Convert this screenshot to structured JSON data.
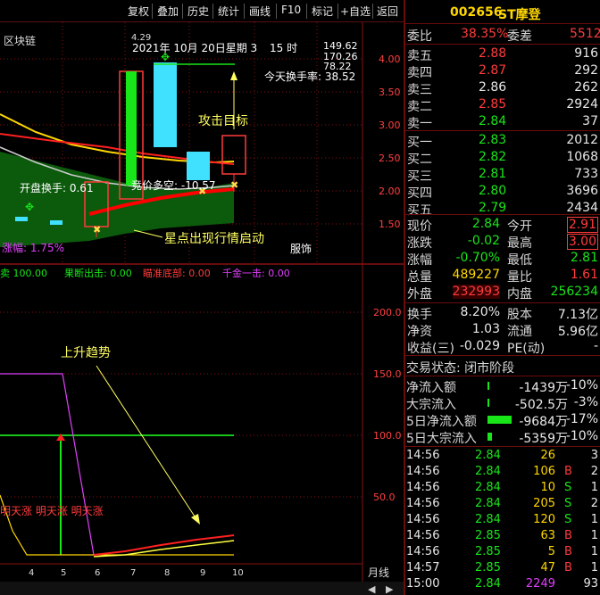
{
  "toolbar": {
    "buttons": [
      "复权",
      "叠加",
      "历史",
      "统计",
      "画线",
      "F10",
      "标记",
      "+自选",
      "返回"
    ]
  },
  "upper_chart": {
    "legend_left": "区块链",
    "date_label": "2021年 10月 20日星期 3",
    "time_label": "15 时",
    "marker_label": "4.29",
    "info_values": [
      "149.62",
      "170.26",
      "78.22"
    ],
    "turnover_label": "今天换手率: 38.52",
    "attack_label": "攻击目标",
    "open_turnover_label": "开盘换手: 0.61",
    "bid_label": "竞价多空: -10.57",
    "star_label": "星点出现行情启动",
    "rise_label": "涨幅: 1.75%",
    "obey_label": "服饰",
    "y_ticks": [
      "4.00",
      "3.50",
      "3.00",
      "2.50",
      "2.00",
      "1.50"
    ]
  },
  "lower_chart": {
    "indicators": [
      {
        "label": "卖 100.00",
        "color": "#19e619"
      },
      {
        "label": "果断出击: 0.00",
        "color": "#19e619"
      },
      {
        "label": "瞄准底部: 0.00",
        "color": "#ff3b3b"
      },
      {
        "label": "千金一击: 0.00",
        "color": "#e040fb"
      }
    ],
    "trend_label": "上升趋势",
    "tomorrow_label": "明天涨 明天涨 明天涨",
    "y_ticks": [
      "200.0",
      "150.0",
      "100.0",
      "50.0"
    ],
    "x_ticks": [
      "4",
      "5",
      "6",
      "7",
      "8",
      "9",
      "10"
    ],
    "period_label": "月线"
  },
  "quote": {
    "code": "002656",
    "name": "ST摩登",
    "weibi_label": "委比",
    "weibi_value": "38.35%",
    "weicha_label": "委差",
    "weicha_value": "5512",
    "asks": [
      {
        "label": "卖五",
        "price": "2.88",
        "vol": "916"
      },
      {
        "label": "卖四",
        "price": "2.87",
        "vol": "292"
      },
      {
        "label": "卖三",
        "price": "2.86",
        "vol": "262"
      },
      {
        "label": "卖二",
        "price": "2.85",
        "vol": "2924"
      },
      {
        "label": "卖一",
        "price": "2.84",
        "vol": "37"
      }
    ],
    "bids": [
      {
        "label": "买一",
        "price": "2.83",
        "vol": "2012"
      },
      {
        "label": "买二",
        "price": "2.82",
        "vol": "1068"
      },
      {
        "label": "买三",
        "price": "2.81",
        "vol": "733"
      },
      {
        "label": "买四",
        "price": "2.80",
        "vol": "3696"
      },
      {
        "label": "买五",
        "price": "2.79",
        "vol": "2434"
      }
    ],
    "stats": [
      {
        "l1": "现价",
        "v1": "2.84",
        "c1": "#19e619",
        "l2": "今开",
        "v2": "2.91",
        "c2": "#ff3b3b"
      },
      {
        "l1": "涨跌",
        "v1": "-0.02",
        "c1": "#19e619",
        "l2": "最高",
        "v2": "3.00",
        "c2": "#ff3b3b"
      },
      {
        "l1": "涨幅",
        "v1": "-0.70%",
        "c1": "#19e619",
        "l2": "最低",
        "v2": "2.81",
        "c2": "#19e619"
      },
      {
        "l1": "总量",
        "v1": "489227",
        "c1": "#ffd700",
        "l2": "量比",
        "v2": "1.61",
        "c2": "#ff3b3b"
      },
      {
        "l1": "外盘",
        "v1": "232993",
        "c1": "#ff3b3b",
        "l2": "内盘",
        "v2": "256234",
        "c2": "#19e619"
      }
    ],
    "fund": [
      {
        "l1": "换手",
        "v1": "8.20%",
        "l2": "股本",
        "v2": "7.13亿"
      },
      {
        "l1": "净资",
        "v1": "1.03",
        "l2": "流通",
        "v2": "5.96亿"
      },
      {
        "l1": "收益(三)",
        "v1": "-0.029",
        "l2": "PE(动)",
        "v2": "-"
      }
    ],
    "trade_status": "交易状态: 闭市阶段",
    "flows": [
      {
        "label": "净流入额",
        "value": "-1439万",
        "pct": "-10%",
        "bar": 0.05
      },
      {
        "label": "大宗流入",
        "value": "-502.5万",
        "pct": "-3%",
        "bar": 0.04
      },
      {
        "label": "5日净流入额",
        "value": "-9684万",
        "pct": "-17%",
        "bar": 0.95
      },
      {
        "label": "5日大宗流入",
        "value": "-5359万",
        "pct": "-10%",
        "bar": 0.18
      }
    ],
    "ticks": [
      {
        "time": "14:56",
        "price": "2.84",
        "vol": "26",
        "bs": "",
        "n": "3"
      },
      {
        "time": "14:56",
        "price": "2.84",
        "vol": "106",
        "bs": "B",
        "n": "2"
      },
      {
        "time": "14:56",
        "price": "2.84",
        "vol": "10",
        "bs": "S",
        "n": "1"
      },
      {
        "time": "14:56",
        "price": "2.84",
        "vol": "205",
        "bs": "S",
        "n": "2"
      },
      {
        "time": "14:56",
        "price": "2.84",
        "vol": "120",
        "bs": "S",
        "n": "1"
      },
      {
        "time": "14:56",
        "price": "2.85",
        "vol": "63",
        "bs": "B",
        "n": "1"
      },
      {
        "time": "14:56",
        "price": "2.85",
        "vol": "5",
        "bs": "B",
        "n": "1"
      },
      {
        "time": "14:57",
        "price": "2.85",
        "vol": "47",
        "bs": "B",
        "n": "1"
      },
      {
        "time": "15:00",
        "price": "2.84",
        "vol": "2249",
        "bs": "",
        "n": "93"
      }
    ]
  }
}
